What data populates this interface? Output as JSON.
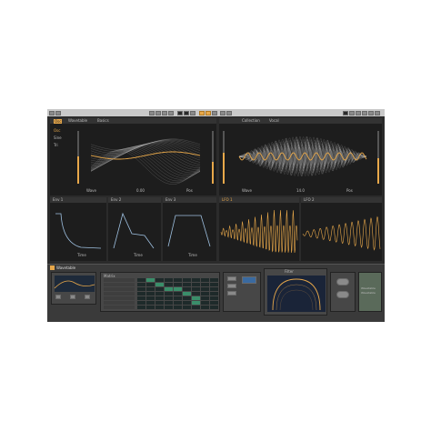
{
  "transport": {
    "buttons": [
      "play",
      "stop",
      "record",
      "loop",
      "metronome"
    ]
  },
  "left_osc": {
    "badge": "Osc",
    "title": "Wavetable",
    "preset": "Basics",
    "left_labels": [
      "Osc",
      "Sine",
      "Tri"
    ],
    "bottom_left": "Wave",
    "bottom_mid": "0.00",
    "bottom_right": "Pos"
  },
  "right_osc": {
    "title": "Collection",
    "preset": "Vocal",
    "bottom_left": "Wave",
    "bottom_mid": "14.0",
    "bottom_right": "Pos"
  },
  "env_panels": [
    {
      "title": "Env 1",
      "label": "Time"
    },
    {
      "title": "Env 2",
      "label": "Time"
    },
    {
      "title": "Env 3",
      "label": "Time"
    }
  ],
  "lfo_panels": [
    {
      "title": "LFO 1"
    },
    {
      "title": "LFO 2"
    }
  ],
  "bottom": {
    "device_title": "Wavetable",
    "matrix_label": "Matrix",
    "filter_label": "Filter",
    "right_label_1": "Wavetable",
    "right_label_2": "Wavetable"
  },
  "colors": {
    "accent": "#e8a84a",
    "panel": "#1d1d1d",
    "bg": "#2b2b2b"
  }
}
